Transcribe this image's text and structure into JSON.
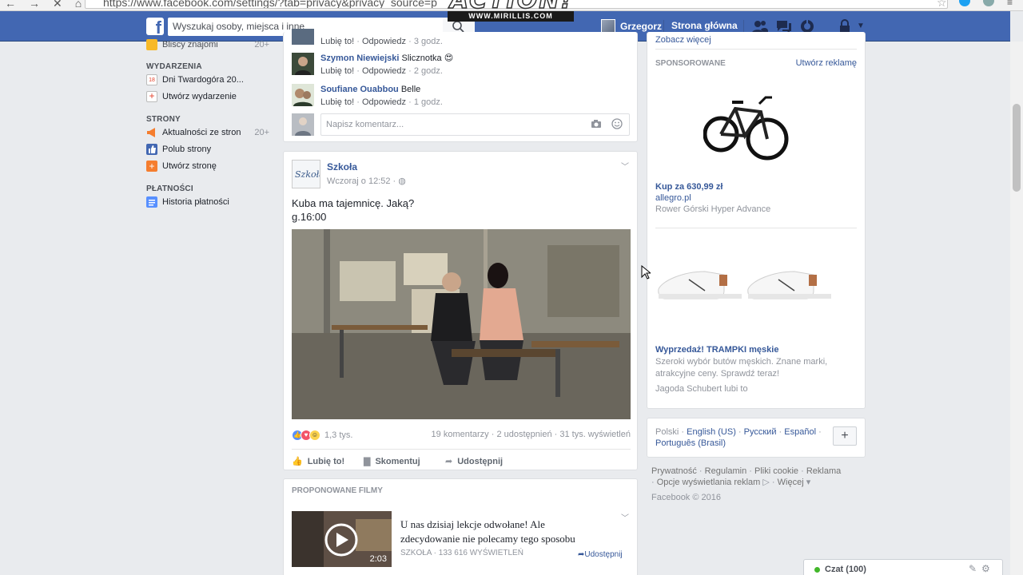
{
  "browser": {
    "url": "https://www.facebook.com/settings/?tab=privacy&privacy_source=p"
  },
  "colors": {
    "fb_blue": "#4267b2",
    "link": "#365899",
    "background": "#e9ebee",
    "online": "#42b72a"
  },
  "watermark": {
    "brand": "ACTION!",
    "site": "WWW.MIRILLIS.COM"
  },
  "topbar": {
    "search_placeholder": "Wyszukaj osoby, miejsca i inne",
    "user_name": "Grzegorz",
    "home_label": "Strona główna",
    "icons": [
      "friends-icon",
      "messages-icon",
      "notifications-icon",
      "privacy-lock-icon",
      "dropdown-arrow-icon"
    ]
  },
  "sidebar": {
    "top_item": {
      "label": "Bliscy znajomi",
      "count": "20+"
    },
    "sections": [
      {
        "title": "WYDARZENIA",
        "items": [
          {
            "label": "Dni Twardogóra 20...",
            "icon": "calendar-icon"
          },
          {
            "label": "Utwórz wydarzenie",
            "icon": "create-event-icon"
          }
        ]
      },
      {
        "title": "STRONY",
        "items": [
          {
            "label": "Aktualności ze stron",
            "count": "20+",
            "icon": "megaphone-icon"
          },
          {
            "label": "Polub strony",
            "icon": "like-page-icon"
          },
          {
            "label": "Utwórz stronę",
            "icon": "create-page-icon"
          }
        ]
      },
      {
        "title": "PŁATNOŚCI",
        "items": [
          {
            "label": "Historia płatności",
            "icon": "payment-history-icon"
          }
        ]
      }
    ]
  },
  "comments": [
    {
      "author": "",
      "text": "",
      "like_label": "Lubię to!",
      "reply_label": "Odpowiedz",
      "time": "3 godz."
    },
    {
      "author": "Szymon Niewiejski",
      "text": "Slicznotka",
      "emoji": "😍",
      "like_label": "Lubię to!",
      "reply_label": "Odpowiedz",
      "time": "2 godz."
    },
    {
      "author": "Soufiane Ouabbou",
      "text": "Belle",
      "like_label": "Lubię to!",
      "reply_label": "Odpowiedz",
      "time": "1 godz."
    }
  ],
  "comment_input": {
    "placeholder": "Napisz komentarz..."
  },
  "post": {
    "author": "Szkoła",
    "avatar_text": "Szkoła",
    "time": "Wczoraj o 12:52 · ",
    "text": "Kuba ma tajemnicę. Jaką?\ng.16:00",
    "reaction_count": "1,3 tys.",
    "stats": "19 komentarzy · 2 udostępnień · 31 tys. wyświetleń",
    "actions": {
      "like": "Lubię to!",
      "comment": "Skomentuj",
      "share": "Udostępnij"
    }
  },
  "suggested": {
    "title": "PROPONOWANE FILMY",
    "video_title": "U nas dzisiaj lekcje odwołane! Ale zdecydowanie nie polecamy tego sposobu",
    "meta": "SZKOŁA · 133 616 WYŚWIETLEŃ",
    "share": "Udostępnij",
    "duration": "2:03"
  },
  "sponsored": {
    "title": "SPONSOROWANE",
    "create_ad": "Utwórz reklamę",
    "top_link": "Zobacz więcej",
    "ads": [
      {
        "headline": "Kup za 630,99 zł",
        "domain": "allegro.pl",
        "description": "Rower Górski Hyper Advance"
      },
      {
        "headline": "Wyprzedaż! TRAMPKI męskie",
        "description": "Szeroki wybór butów męskich. Znane marki, atrakcyjne ceny. Sprawdź teraz!",
        "social": "Jagoda Schubert lubi to"
      }
    ]
  },
  "languages": {
    "current": "Polski",
    "options": [
      "English (US)",
      "Русский",
      "Español",
      "Português (Brasil)"
    ],
    "plus": "+"
  },
  "footer": {
    "links": [
      "Prywatność",
      "Regulamin",
      "Pliki cookie",
      "Reklama",
      "Opcje wyświetlania reklam",
      "Więcej"
    ],
    "copyright": "Facebook © 2016"
  },
  "chat": {
    "label": "Czat (100)"
  }
}
